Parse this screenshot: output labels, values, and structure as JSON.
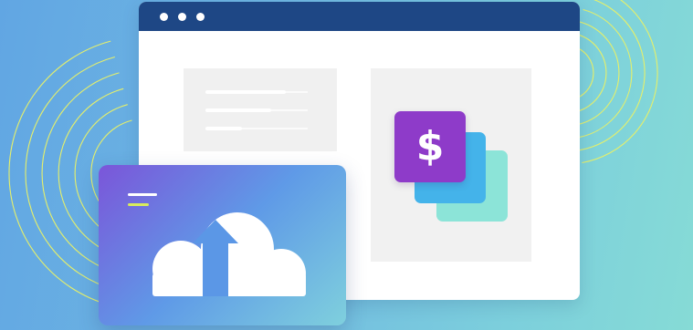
{
  "illustration": {
    "kind": "cloud-payment-upload",
    "colors": {
      "background_start": "#61a6e3",
      "background_end": "#86dbd6",
      "browser_bar": "#1e4785",
      "browser_body": "#ffffff",
      "panel": "#f0f0f0",
      "card_front": "#8e3bc9",
      "card_middle": "#44b3ea",
      "card_back": "#8ce4d8",
      "upload_gradient_start": "#7b55d9",
      "upload_gradient_end": "#7fd0dd",
      "accent_line": "#d8ec5c",
      "arc_stroke": "#e6f06a"
    },
    "browser": {
      "window_dots": 3
    },
    "payment": {
      "symbol": "$",
      "stacked_cards": 3
    },
    "upload": {
      "icons": [
        "cloud-icon",
        "upload-arrow-icon",
        "menu-icon"
      ]
    }
  }
}
